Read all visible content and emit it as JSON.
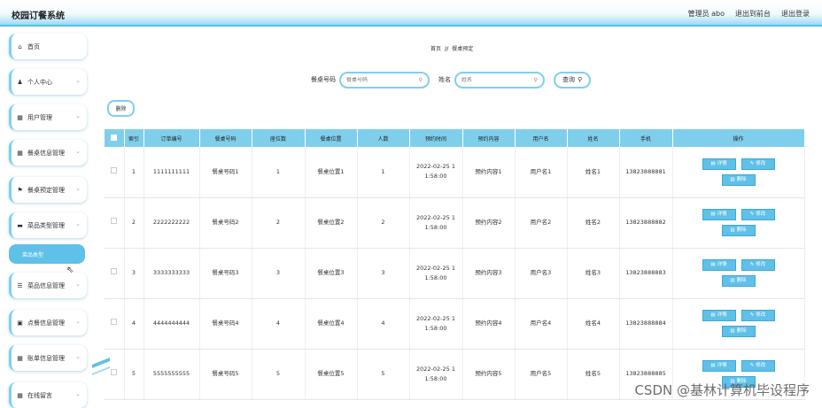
{
  "app": {
    "title": "校园订餐系统"
  },
  "topbar": {
    "user": "管理员 abo",
    "back_label": "退出到前台",
    "logout_label": "退出登录"
  },
  "sidebar": {
    "items": [
      {
        "label": "首页",
        "icon": "home-icon",
        "glyph": "⌂",
        "chevron": false
      },
      {
        "label": "个人中心",
        "icon": "user-icon",
        "glyph": "♟",
        "chevron": true
      },
      {
        "label": "用户管理",
        "icon": "grid-icon",
        "glyph": "▦",
        "chevron": true
      },
      {
        "label": "餐桌信息管理",
        "icon": "grid-icon",
        "glyph": "▦",
        "chevron": true
      },
      {
        "label": "餐桌预定管理",
        "icon": "flag-icon",
        "glyph": "⚑",
        "chevron": true
      },
      {
        "label": "菜品类型管理",
        "icon": "card-icon",
        "glyph": "▬",
        "chevron": true
      },
      {
        "label": "菜品信息管理",
        "icon": "list-icon",
        "glyph": "☰",
        "chevron": true
      },
      {
        "label": "点餐信息管理",
        "icon": "doc-icon",
        "glyph": "▣",
        "chevron": true
      },
      {
        "label": "账单信息管理",
        "icon": "grid-icon",
        "glyph": "▦",
        "chevron": true
      },
      {
        "label": "在线留言",
        "icon": "grid-icon",
        "glyph": "▦",
        "chevron": true
      }
    ],
    "submenu": {
      "label": "菜品类型"
    }
  },
  "breadcrumb": {
    "home": "首页",
    "sep": "//",
    "current": "餐桌预定"
  },
  "search": {
    "field1_label": "餐桌号码",
    "field1_placeholder": "餐桌号码",
    "field2_label": "姓名",
    "field2_placeholder": "姓名",
    "query_label": "查询"
  },
  "toolbar": {
    "delete_label": "删除"
  },
  "table": {
    "headers": [
      "索引",
      "订单编号",
      "餐桌号码",
      "座位数",
      "餐桌位置",
      "人数",
      "预约时间",
      "预约内容",
      "用户名",
      "姓名",
      "手机",
      "操作"
    ],
    "rows": [
      {
        "idx": "1",
        "order": "1111111111",
        "table_no": "餐桌号码1",
        "seats": "1",
        "loc": "餐桌位置1",
        "people": "1",
        "time_a": "2022-02-25 1",
        "time_b": "1:58:00",
        "content": "预约内容1",
        "username": "用户名1",
        "name": "姓名1",
        "phone": "13823888881"
      },
      {
        "idx": "2",
        "order": "2222222222",
        "table_no": "餐桌号码2",
        "seats": "2",
        "loc": "餐桌位置2",
        "people": "2",
        "time_a": "2022-02-25 1",
        "time_b": "1:58:00",
        "content": "预约内容2",
        "username": "用户名2",
        "name": "姓名2",
        "phone": "13823888882"
      },
      {
        "idx": "3",
        "order": "3333333333",
        "table_no": "餐桌号码3",
        "seats": "3",
        "loc": "餐桌位置3",
        "people": "3",
        "time_a": "2022-02-25 1",
        "time_b": "1:58:00",
        "content": "预约内容3",
        "username": "用户名3",
        "name": "姓名3",
        "phone": "13823888883"
      },
      {
        "idx": "4",
        "order": "4444444444",
        "table_no": "餐桌号码4",
        "seats": "4",
        "loc": "餐桌位置4",
        "people": "4",
        "time_a": "2022-02-25 1",
        "time_b": "1:58:00",
        "content": "预约内容4",
        "username": "用户名4",
        "name": "姓名4",
        "phone": "13823888884"
      },
      {
        "idx": "5",
        "order": "5555555555",
        "table_no": "餐桌号码5",
        "seats": "5",
        "loc": "餐桌位置5",
        "people": "5",
        "time_a": "2022-02-25 1",
        "time_b": "1:58:00",
        "content": "预约内容5",
        "username": "用户名5",
        "name": "姓名5",
        "phone": "13823888885"
      }
    ],
    "ops": {
      "detail": "详情",
      "edit": "修改",
      "delete": "删除"
    }
  },
  "watermark": "CSDN @基林计算机毕设程序",
  "colors": {
    "accent": "#5fc0e8",
    "border": "#7fcfec",
    "header": "#7fcfec"
  }
}
